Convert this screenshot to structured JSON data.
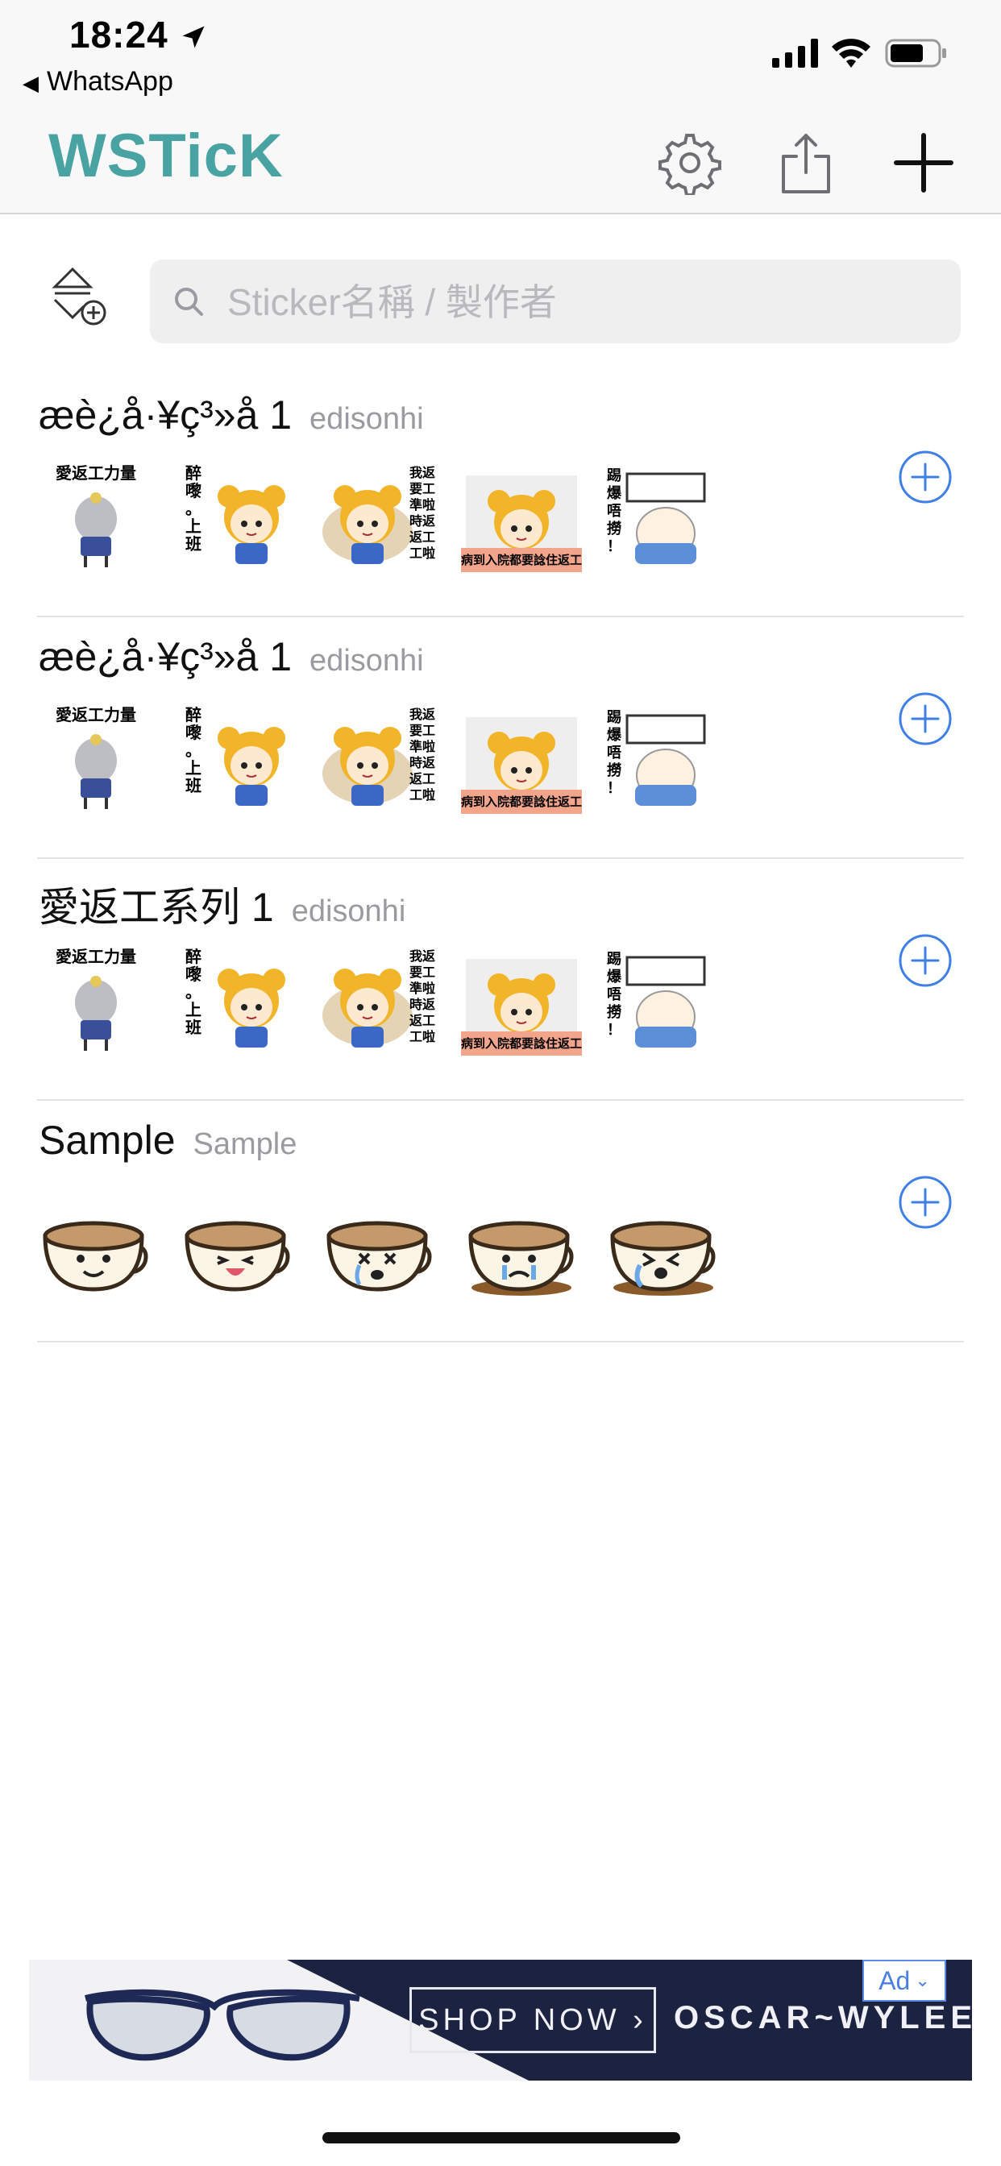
{
  "status_bar": {
    "time": "18:24",
    "back_app": "WhatsApp"
  },
  "nav": {
    "title": "WSTicK",
    "icons": [
      "gear-icon",
      "share-icon",
      "plus-icon"
    ]
  },
  "search": {
    "placeholder": "Sticker名稱 / 製作者",
    "value": ""
  },
  "packs": [
    {
      "name": "æè¿å·¥ç³»å 1",
      "author": "edisonhi",
      "sticker_set": "popteam"
    },
    {
      "name": "æè¿å·¥ç³»å 1",
      "author": "edisonhi",
      "sticker_set": "popteam"
    },
    {
      "name": "愛返工系列 1",
      "author": "edisonhi",
      "sticker_set": "popteam"
    },
    {
      "name": "Sample",
      "author": "Sample",
      "sticker_set": "cups"
    }
  ],
  "sticker_captions": {
    "s1": "愛返工力量",
    "s2": "醉嚟。上班",
    "s3": [
      "我返",
      "要工",
      "準啦",
      "時返",
      "返工",
      "工啦"
    ],
    "s4": "病到入院都要諗住返工",
    "s5": "踢爆唔撈！"
  },
  "ad": {
    "badge": "Ad",
    "cta": "SHOP NOW ›",
    "brand": "OSCAR~WYLEE"
  },
  "colors": {
    "brand": "#4aa3a3",
    "accent": "#3f7fe6"
  }
}
